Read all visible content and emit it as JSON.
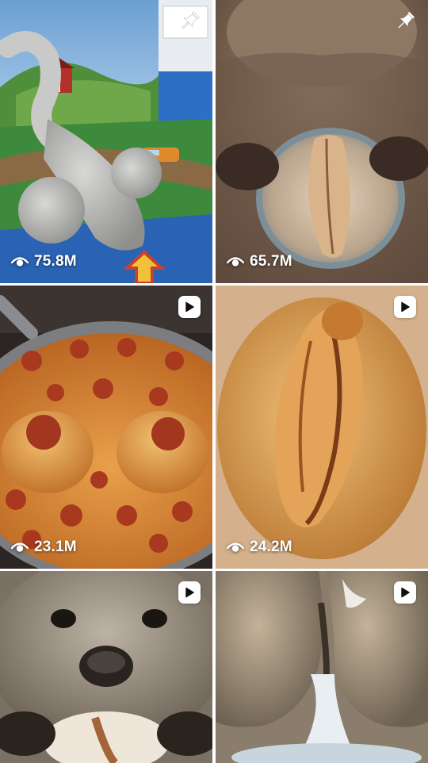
{
  "feed": {
    "tiles": [
      {
        "id": 1,
        "badge_icon": "pin-icon",
        "views": "75.8M",
        "media_type": "pinned photo"
      },
      {
        "id": 2,
        "badge_icon": "pin-icon",
        "views": "65.7M",
        "media_type": "pinned photo"
      },
      {
        "id": 3,
        "badge_icon": "play-icon",
        "views": "23.1M",
        "media_type": "video"
      },
      {
        "id": 4,
        "badge_icon": "play-icon",
        "views": "24.2M",
        "media_type": "video"
      },
      {
        "id": 5,
        "badge_icon": "play-icon",
        "views": "",
        "media_type": "video"
      },
      {
        "id": 6,
        "badge_icon": "play-icon",
        "views": "",
        "media_type": "video"
      }
    ],
    "view_icon": "eye-icon",
    "colors": {
      "overlay_text": "#ffffff",
      "badge_bg": "#ffffff",
      "page_bg": "#ffffff"
    }
  }
}
